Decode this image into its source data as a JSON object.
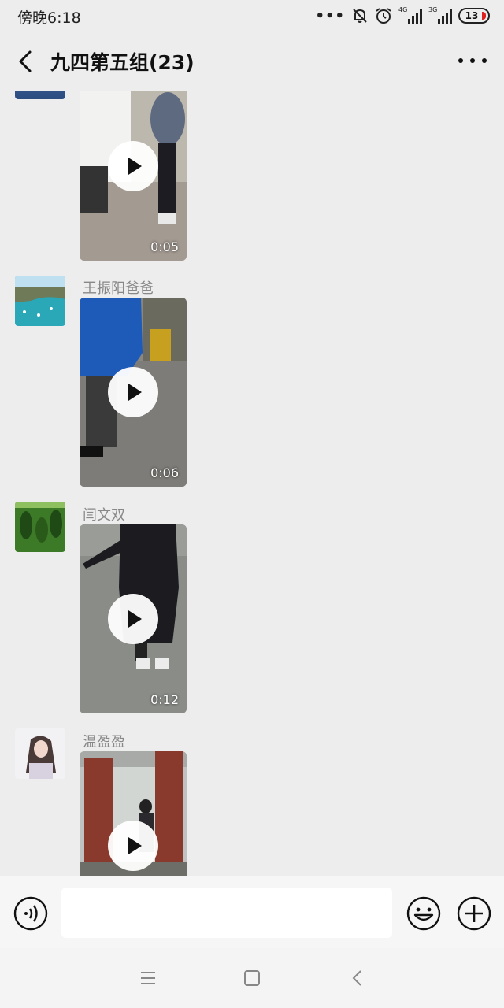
{
  "status_bar": {
    "time": "傍晚6:18",
    "signal_1_label": "4G",
    "signal_2_label": "3G",
    "battery": "13",
    "icons": [
      "more-dots-icon",
      "mute-bell-icon",
      "alarm-icon",
      "signal-4g-icon",
      "signal-3g-icon",
      "battery-icon"
    ]
  },
  "title_bar": {
    "title": "九四第五组(23)",
    "back_icon": "chevron-left-icon",
    "more_icon": "more-dots-icon"
  },
  "messages": [
    {
      "sender": "",
      "duration": "0:05",
      "play_icon": "play-icon"
    },
    {
      "sender": "王振阳爸爸",
      "duration": "0:06",
      "play_icon": "play-icon"
    },
    {
      "sender": "闫文双",
      "duration": "0:12",
      "play_icon": "play-icon"
    },
    {
      "sender": "温盈盈",
      "duration": "",
      "play_icon": "play-icon"
    }
  ],
  "input_bar": {
    "value": "",
    "placeholder": "",
    "icons": [
      "voice-icon",
      "emoji-icon",
      "plus-icon"
    ]
  },
  "nav_bar": {
    "icons": [
      "menu-icon",
      "home-icon",
      "back-icon"
    ]
  },
  "colors": {
    "background": "#ededed",
    "input_bar": "#f6f6f6",
    "sender_text": "#888888",
    "battery_low": "#e02020"
  }
}
